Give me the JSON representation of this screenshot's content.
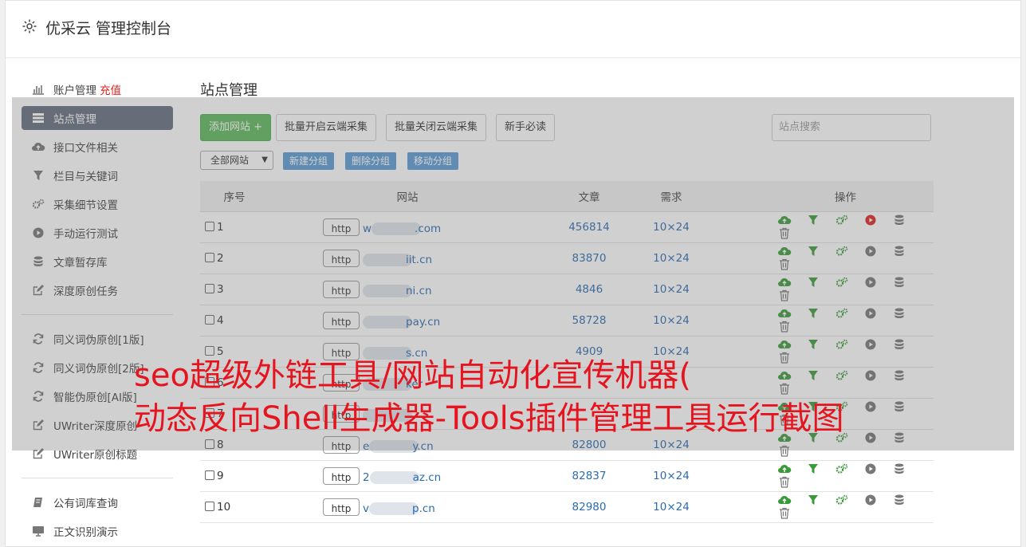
{
  "app": {
    "title": "优采云 管理控制台"
  },
  "sidebar": {
    "group1": [
      {
        "label": "账户管理",
        "badge": "充值",
        "icon": "bar-chart-icon"
      },
      {
        "label": "站点管理",
        "icon": "list-icon",
        "active": true
      },
      {
        "label": "接口文件相关",
        "icon": "cloud-upload-icon"
      },
      {
        "label": "栏目与关键词",
        "icon": "filter-icon"
      },
      {
        "label": "采集细节设置",
        "icon": "gears-icon"
      },
      {
        "label": "手动运行测试",
        "icon": "play-circle-icon"
      },
      {
        "label": "文章暂存库",
        "icon": "database-icon"
      },
      {
        "label": "深度原创任务",
        "icon": "edit-icon"
      }
    ],
    "group2": [
      {
        "label": "同义词伪原创[1版]",
        "icon": "refresh-icon"
      },
      {
        "label": "同义词伪原创[2版]",
        "icon": "refresh-icon"
      },
      {
        "label": "智能伪原创[AI版]",
        "icon": "refresh-icon"
      },
      {
        "label": "UWriter深度原创",
        "icon": "edit-icon"
      },
      {
        "label": "UWriter原创标题",
        "icon": "edit-icon"
      }
    ],
    "group3": [
      {
        "label": "公有词库查询",
        "icon": "book-icon"
      },
      {
        "label": "正文识别演示",
        "icon": "monitor-icon"
      }
    ]
  },
  "main": {
    "title": "站点管理",
    "toolbar": {
      "add_site": "添加网站 +",
      "batch_open": "批量开启云端采集",
      "batch_close": "批量关闭云端采集",
      "newbie": "新手必读",
      "search_placeholder": "站点搜索"
    },
    "group_select": "全部网站",
    "group_buttons": {
      "new": "新建分组",
      "delete": "删除分组",
      "move": "移动分组"
    },
    "table": {
      "headers": {
        "no": "序号",
        "site": "网站",
        "articles": "文章",
        "demand": "需求",
        "ops": "操作"
      },
      "rows": [
        {
          "no": "1",
          "prefix": "http",
          "domain": "w",
          "suffix": ".com",
          "articles": "456814",
          "demand": "10×24",
          "running": true
        },
        {
          "no": "2",
          "prefix": "http",
          "domain": "",
          "suffix": "iit.cn",
          "articles": "83870",
          "demand": "10×24",
          "running": false
        },
        {
          "no": "3",
          "prefix": "http",
          "domain": "",
          "suffix": "ni.cn",
          "articles": "4846",
          "demand": "10×24",
          "running": false
        },
        {
          "no": "4",
          "prefix": "http",
          "domain": "",
          "suffix": "pay.cn",
          "articles": "58728",
          "demand": "10×24",
          "running": false
        },
        {
          "no": "5",
          "prefix": "http",
          "domain": "",
          "suffix": "s.cn",
          "articles": "4909",
          "demand": "10×24",
          "running": false
        },
        {
          "no": "6",
          "prefix": "http",
          "domain": "",
          "suffix": "ker",
          "articles": "",
          "demand": "",
          "running": false
        },
        {
          "no": "7",
          "prefix": "http",
          "domain": "",
          "suffix": "",
          "articles": "",
          "demand": "",
          "running": false
        },
        {
          "no": "8",
          "prefix": "http",
          "domain": "e",
          "suffix": "y.cn",
          "articles": "82800",
          "demand": "10×24",
          "running": false
        },
        {
          "no": "9",
          "prefix": "http",
          "domain": "2",
          "suffix": "az.cn",
          "articles": "82837",
          "demand": "10×24",
          "running": false
        },
        {
          "no": "10",
          "prefix": "http",
          "domain": "v",
          "suffix": "p.cn",
          "articles": "82980",
          "demand": "10×24",
          "running": false
        }
      ]
    }
  },
  "watermark": {
    "line1": "seo超级外链工具/网站自动化宣传机器(",
    "line2": "动态反向Shell生成器-Tools插件管理工具运行截图"
  },
  "colors": {
    "accent_green": "#5cb85c",
    "link_blue": "#2a6bb0",
    "run_red": "#e02020",
    "active_nav": "#656d7e",
    "watermark": "#e6141e"
  }
}
